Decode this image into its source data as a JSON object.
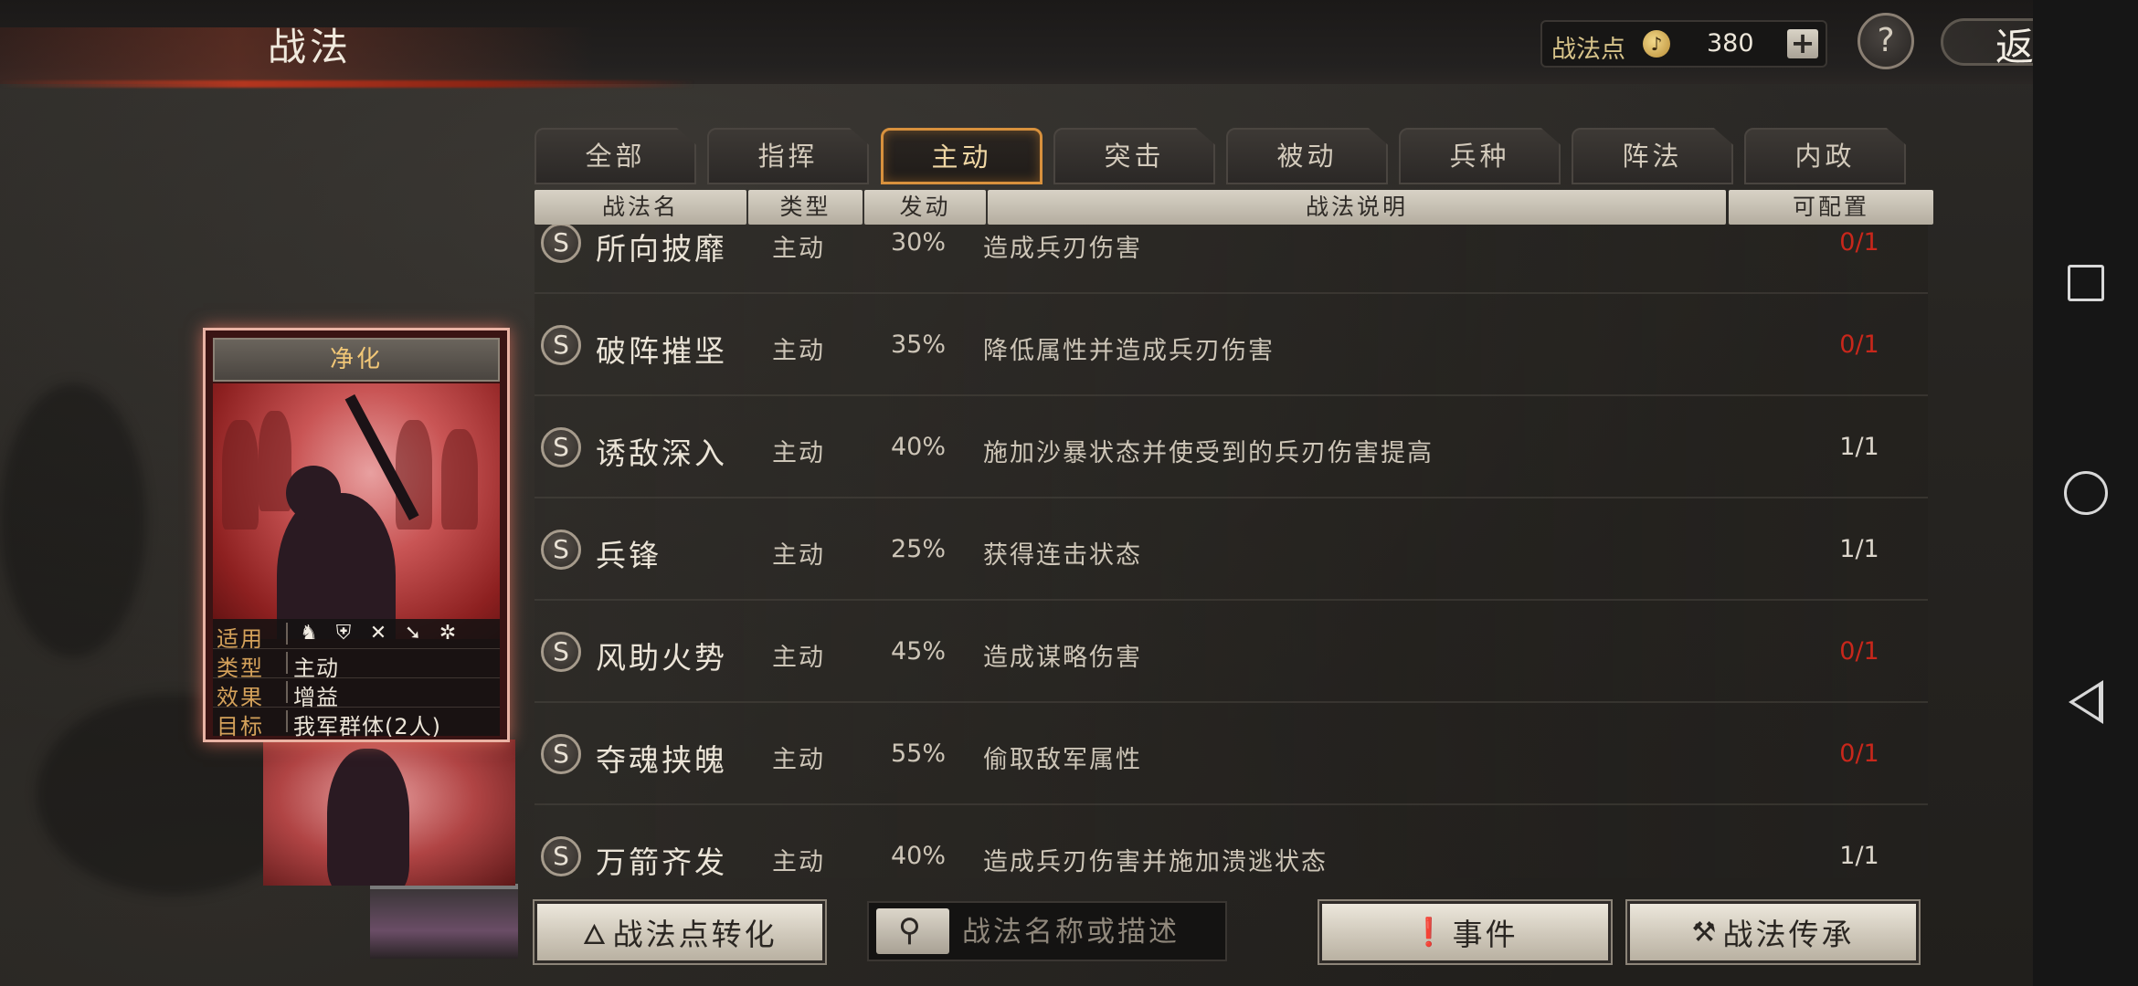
{
  "header": {
    "title": "战法",
    "points_label": "战法点",
    "points_value": "380",
    "add_symbol": "+",
    "help_symbol": "?",
    "back_label": "返回"
  },
  "tabs": [
    {
      "label": "全部",
      "active": false
    },
    {
      "label": "指挥",
      "active": false
    },
    {
      "label": "主动",
      "active": true
    },
    {
      "label": "突击",
      "active": false
    },
    {
      "label": "被动",
      "active": false
    },
    {
      "label": "兵种",
      "active": false
    },
    {
      "label": "阵法",
      "active": false
    },
    {
      "label": "内政",
      "active": false
    }
  ],
  "table": {
    "columns": [
      "战法名",
      "类型",
      "发动",
      "战法说明",
      "可配置"
    ],
    "rows": [
      {
        "grade": "S",
        "name": "所向披靡",
        "type": "主动",
        "rate": "30%",
        "desc": "造成兵刃伤害",
        "avail": "0/1",
        "avail_color": "red"
      },
      {
        "grade": "S",
        "name": "破阵摧坚",
        "type": "主动",
        "rate": "35%",
        "desc": "降低属性并造成兵刃伤害",
        "avail": "0/1",
        "avail_color": "red"
      },
      {
        "grade": "S",
        "name": "诱敌深入",
        "type": "主动",
        "rate": "40%",
        "desc": "施加沙暴状态并使受到的兵刃伤害提高",
        "avail": "1/1",
        "avail_color": "normal"
      },
      {
        "grade": "S",
        "name": "兵锋",
        "type": "主动",
        "rate": "25%",
        "desc": "获得连击状态",
        "avail": "1/1",
        "avail_color": "normal"
      },
      {
        "grade": "S",
        "name": "风助火势",
        "type": "主动",
        "rate": "45%",
        "desc": "造成谋略伤害",
        "avail": "0/1",
        "avail_color": "red"
      },
      {
        "grade": "S",
        "name": "夺魂挟魄",
        "type": "主动",
        "rate": "55%",
        "desc": "偷取敌军属性",
        "avail": "0/1",
        "avail_color": "red"
      },
      {
        "grade": "S",
        "name": "万箭齐发",
        "type": "主动",
        "rate": "40%",
        "desc": "造成兵刃伤害并施加溃逃状态",
        "avail": "1/1",
        "avail_color": "normal"
      }
    ]
  },
  "card": {
    "title": "净化",
    "info": [
      {
        "key": "适用",
        "value": ""
      },
      {
        "key": "类型",
        "value": "主动"
      },
      {
        "key": "效果",
        "value": "增益"
      },
      {
        "key": "目标",
        "value": "我军群体(2人)"
      }
    ],
    "unit_icons": [
      "cavalry-icon",
      "shield-icon",
      "bow-icon",
      "spear-icon",
      "vehicle-icon"
    ]
  },
  "bottom": {
    "convert_label": "战法点转化",
    "search_placeholder": "战法名称或描述",
    "event_label": "事件",
    "inherit_label": "战法传承"
  },
  "colors": {
    "accent_orange": "#d8913d",
    "unavailable_red": "#c8271b",
    "brand_red": "#b3361f"
  }
}
